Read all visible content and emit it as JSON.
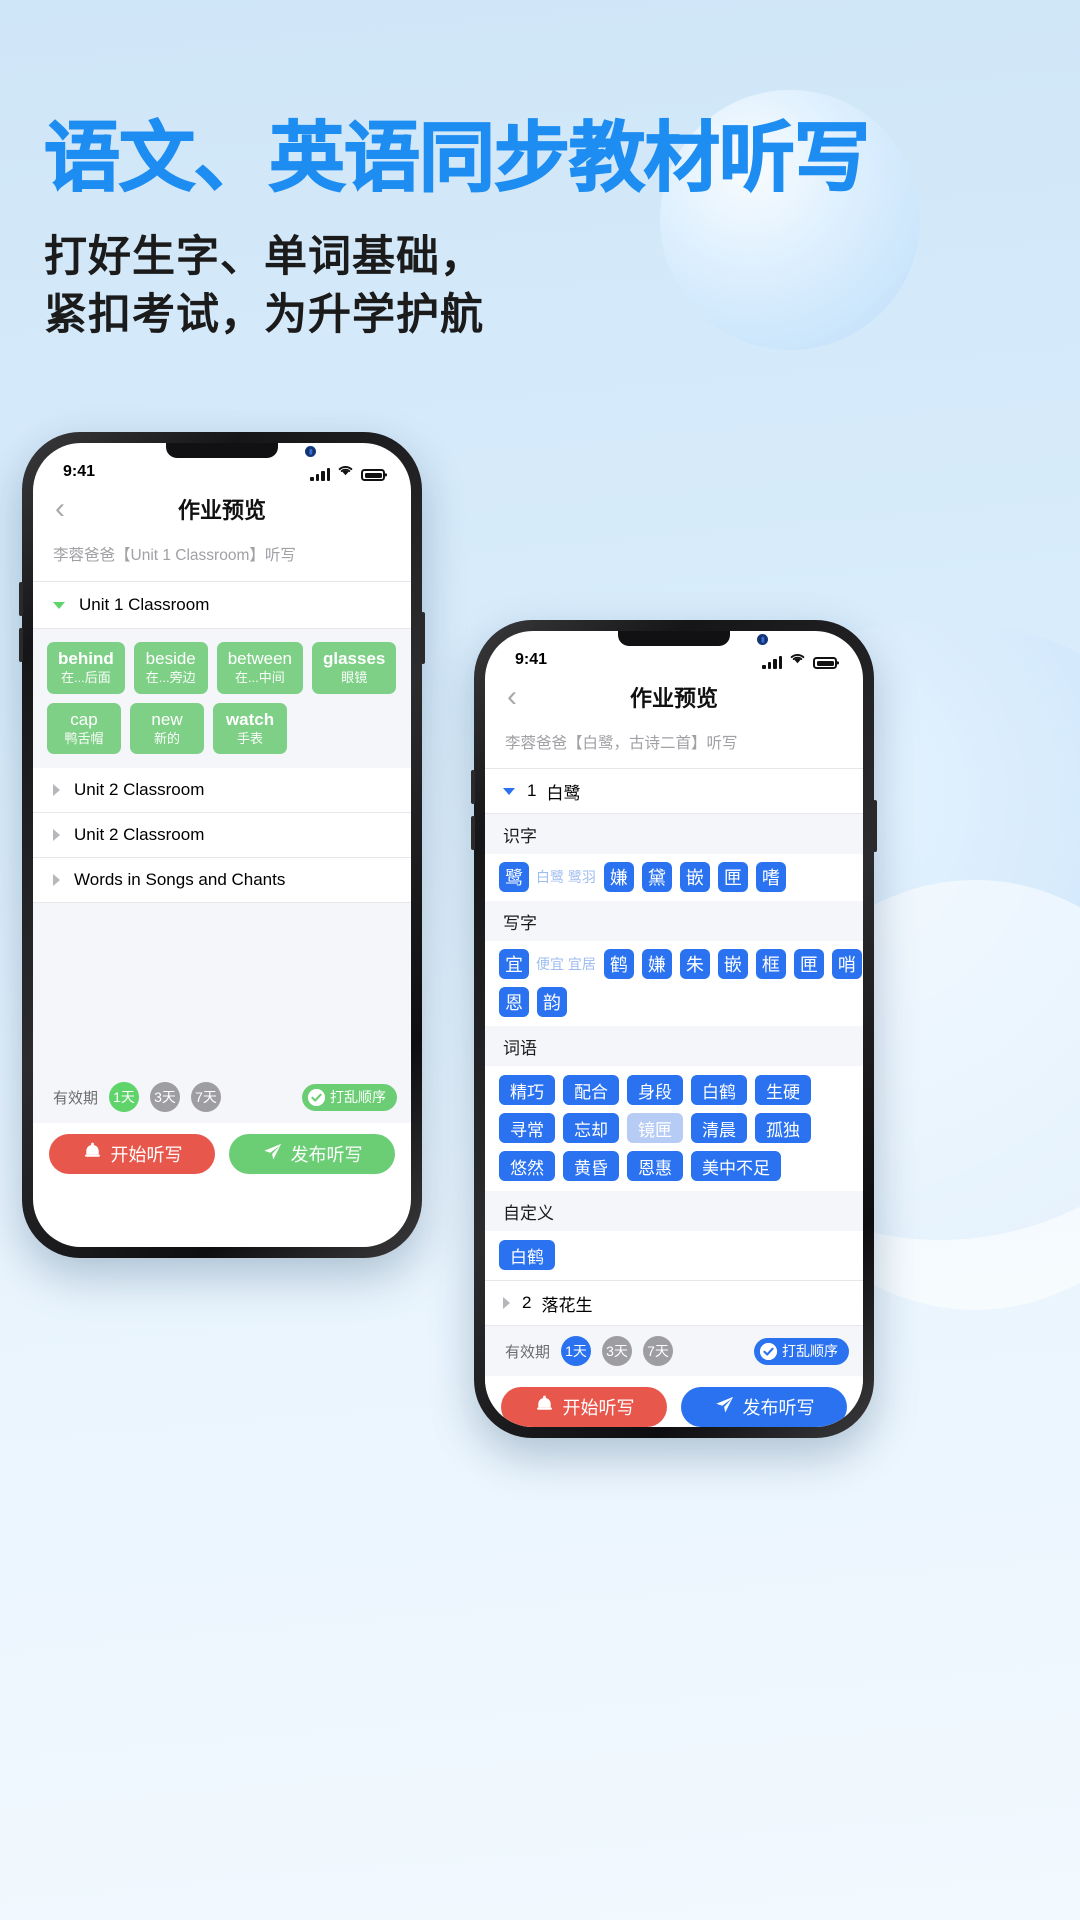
{
  "poster": {
    "headline": "语文、英语同步教材听写",
    "subhead_line1": "打好生字、单词基础，",
    "subhead_line2": "紧扣考试，为升学护航",
    "headline_color": "#1e8df2",
    "background_color": "#d5e8f7"
  },
  "phone_left": {
    "status": {
      "time": "9:41",
      "signal_icon": "cellular-bars-icon",
      "wifi_icon": "wifi-icon",
      "battery_icon": "battery-full-icon"
    },
    "nav": {
      "back_icon": "back-chevron-icon",
      "title": "作业预览"
    },
    "subtitle": "李蓉爸爸【Unit 1 Classroom】听写",
    "units": [
      {
        "label": "Unit 1 Classroom",
        "expanded": true,
        "arrow_icon": "triangle-down-icon"
      },
      {
        "label": "Unit 2 Classroom",
        "expanded": false,
        "arrow_icon": "triangle-right-icon"
      },
      {
        "label": "Unit 2 Classroom",
        "expanded": false,
        "arrow_icon": "triangle-right-icon"
      },
      {
        "label": "Words in Songs and Chants",
        "expanded": false,
        "arrow_icon": "triangle-right-icon"
      }
    ],
    "words": [
      {
        "word": "behind",
        "translation": "在...后面",
        "selected": true
      },
      {
        "word": "beside",
        "translation": "在...旁边",
        "selected": false
      },
      {
        "word": "between",
        "translation": "在...中间",
        "selected": false
      },
      {
        "word": "glasses",
        "translation": "眼镜",
        "selected": true
      },
      {
        "word": "cap",
        "translation": "鸭舌帽",
        "selected": false
      },
      {
        "word": "new",
        "translation": "新的",
        "selected": false
      },
      {
        "word": "watch",
        "translation": "手表",
        "selected": true
      }
    ],
    "footer": {
      "validity_label": "有效期",
      "days": [
        {
          "label": "1天",
          "selected": true
        },
        {
          "label": "3天",
          "selected": false
        },
        {
          "label": "7天",
          "selected": false
        }
      ],
      "shuffle_label": "打乱顺序",
      "shuffle_icon": "check-circle-icon",
      "shuffle_color": "#6bce74",
      "start_label": "开始听写",
      "start_icon": "bell-icon",
      "start_color": "#e8574c",
      "publish_label": "发布听写",
      "publish_icon": "paper-plane-icon",
      "publish_color": "#6bce74"
    }
  },
  "phone_right": {
    "status": {
      "time": "9:41",
      "signal_icon": "cellular-bars-icon",
      "wifi_icon": "wifi-icon",
      "battery_icon": "battery-full-icon"
    },
    "nav": {
      "back_icon": "back-chevron-icon",
      "title": "作业预览"
    },
    "subtitle": "李蓉爸爸【白鹭，古诗二首】听写",
    "lesson_open": {
      "number": "1",
      "title": "白鹭",
      "arrow_icon": "triangle-down-icon"
    },
    "lesson_closed": {
      "number": "2",
      "title": "落花生",
      "arrow_icon": "triangle-right-icon"
    },
    "sections": [
      {
        "title": "识字",
        "lead": {
          "char": "鹭",
          "hint": "白鹭 鹭羽",
          "selected": true
        },
        "chars": [
          {
            "char": "嫌",
            "selected": true
          },
          {
            "char": "黛",
            "selected": true
          },
          {
            "char": "嵌",
            "selected": true
          },
          {
            "char": "匣",
            "selected": true
          },
          {
            "char": "嗜",
            "selected": true
          }
        ]
      },
      {
        "title": "写字",
        "lead": {
          "char": "宜",
          "hint": "便宜 宜居",
          "selected": true
        },
        "chars": [
          {
            "char": "鹤",
            "selected": true
          },
          {
            "char": "嫌",
            "selected": true
          },
          {
            "char": "朱",
            "selected": true
          },
          {
            "char": "嵌",
            "selected": true
          },
          {
            "char": "框",
            "selected": true
          },
          {
            "char": "匣",
            "selected": true
          },
          {
            "char": "哨",
            "selected": true
          },
          {
            "char": "恩",
            "selected": true
          },
          {
            "char": "韵",
            "selected": true
          }
        ]
      }
    ],
    "phrases_title": "词语",
    "phrases": [
      {
        "text": "精巧",
        "selected": true
      },
      {
        "text": "配合",
        "selected": true
      },
      {
        "text": "身段",
        "selected": true
      },
      {
        "text": "白鹤",
        "selected": true
      },
      {
        "text": "生硬",
        "selected": true
      },
      {
        "text": "寻常",
        "selected": true
      },
      {
        "text": "忘却",
        "selected": true
      },
      {
        "text": "镜匣",
        "selected": false
      },
      {
        "text": "清晨",
        "selected": true
      },
      {
        "text": "孤独",
        "selected": true
      },
      {
        "text": "悠然",
        "selected": true
      },
      {
        "text": "黄昏",
        "selected": true
      },
      {
        "text": "恩惠",
        "selected": true
      },
      {
        "text": "美中不足",
        "selected": true
      }
    ],
    "custom_title": "自定义",
    "custom": [
      {
        "text": "白鹤",
        "selected": true
      }
    ],
    "footer": {
      "validity_label": "有效期",
      "days": [
        {
          "label": "1天",
          "selected": true
        },
        {
          "label": "3天",
          "selected": false
        },
        {
          "label": "7天",
          "selected": false
        }
      ],
      "shuffle_label": "打乱顺序",
      "shuffle_icon": "check-circle-icon",
      "shuffle_color": "#2a72f0",
      "start_label": "开始听写",
      "start_icon": "bell-icon",
      "start_color": "#e8574c",
      "publish_label": "发布听写",
      "publish_icon": "paper-plane-icon",
      "publish_color": "#2a72f0"
    }
  }
}
